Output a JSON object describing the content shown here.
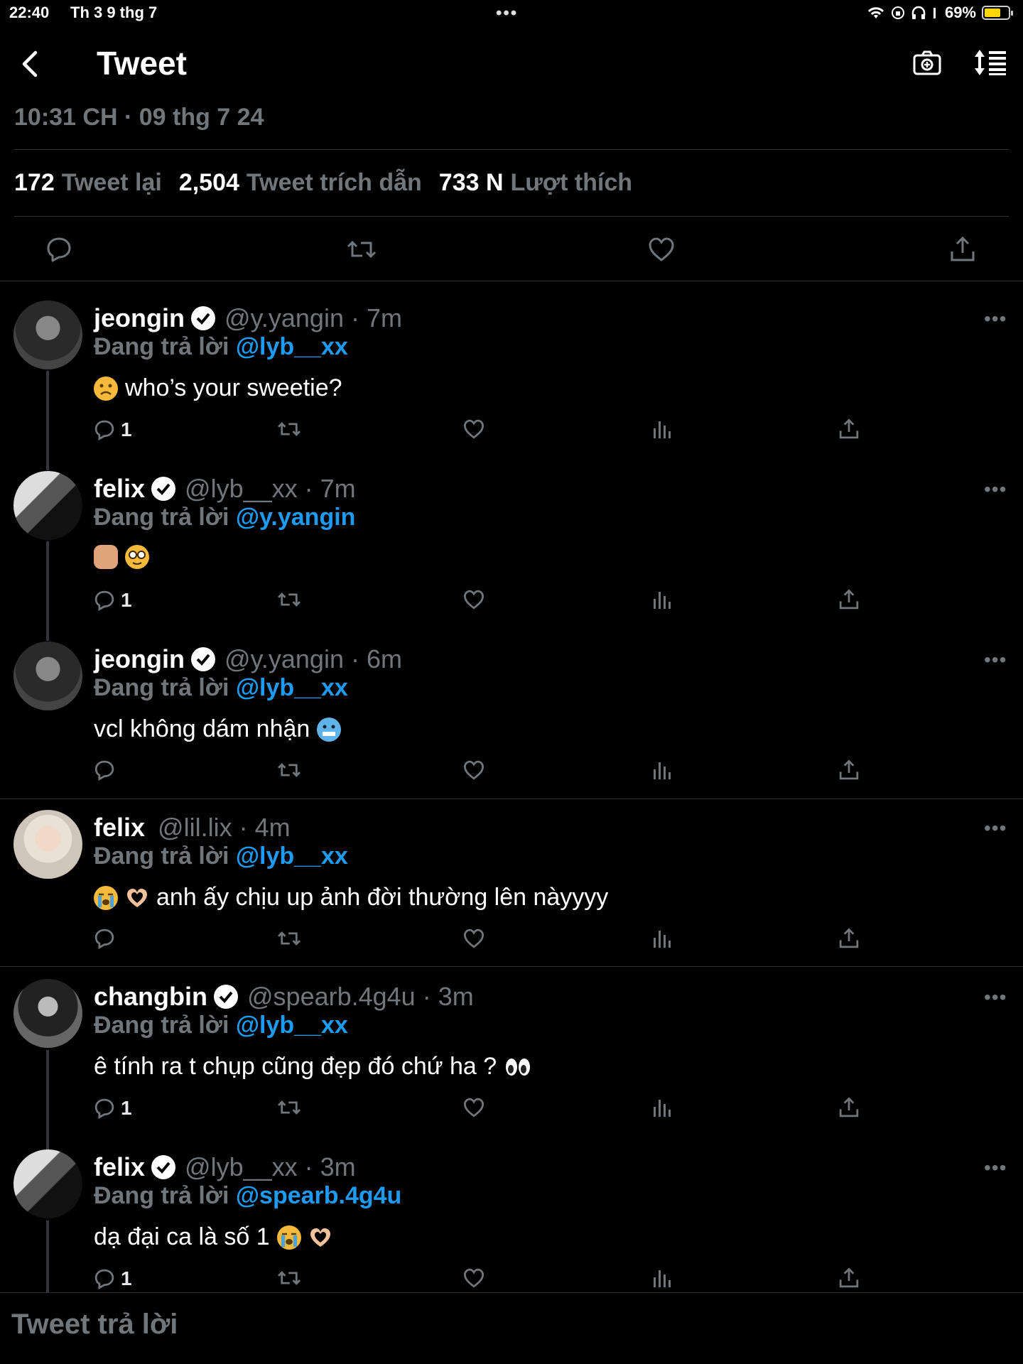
{
  "status": {
    "time": "22:40",
    "date": "Th 3 9 thg 7",
    "battery": "69%",
    "dots": "•••"
  },
  "header": {
    "title": "Tweet"
  },
  "tweet": {
    "timestamp": "10:31 CH · 09 thg 7 24",
    "retweets": "172",
    "retweets_label": "Tweet lại",
    "quotes": "2,504",
    "quotes_label": "Tweet trích dẫn",
    "likes": "733 N",
    "likes_label": "Lượt thích"
  },
  "reply_prefix": "Đang trả lời",
  "replies": [
    {
      "name": "jeongin",
      "handle": "@y.yangin · 7m",
      "to": "@lyb__xx",
      "text": "who’s your sweetie?",
      "reply_count": "1"
    },
    {
      "name": "felix",
      "handle": "@lyb__xx · 7m",
      "to": "@y.yangin",
      "text": "",
      "reply_count": "1"
    },
    {
      "name": "jeongin",
      "handle": "@y.yangin · 6m",
      "to": "@lyb__xx",
      "text": "vcl không dám nhận",
      "reply_count": ""
    },
    {
      "name": "felix",
      "handle": "@lil.lix · 4m",
      "to": "@lyb__xx",
      "text": "anh ấy chịu up ảnh đời thường lên nàyyyy",
      "reply_count": ""
    },
    {
      "name": "changbin",
      "handle": "@spearb.4g4u · 3m",
      "to": "@lyb__xx",
      "text": "ê tính ra t chụp cũng đẹp đó chứ ha ?",
      "reply_count": "1"
    },
    {
      "name": "felix",
      "handle": "@lyb__xx · 3m",
      "to": "@spearb.4g4u",
      "text": "dạ đại ca là số 1",
      "reply_count": "1"
    }
  ],
  "compose": {
    "placeholder": "Tweet trả lời"
  },
  "colors": {
    "accent": "#1d9bf0",
    "muted": "#71767b",
    "bg": "#000000"
  }
}
